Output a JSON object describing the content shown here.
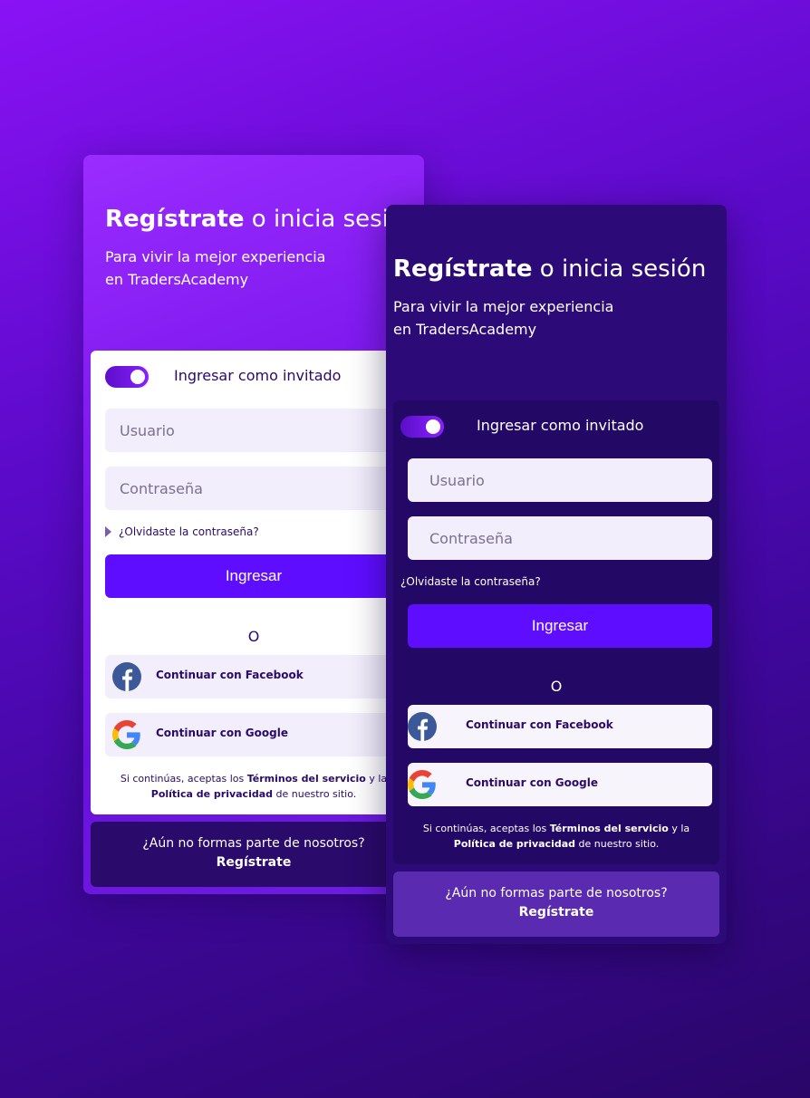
{
  "auth": {
    "heading_bold": "Regístrate",
    "heading_rest": "o inicia sesión",
    "subtitle": "Para vivir la mejor experiencia en TradersAcademy",
    "guest_toggle_label": "Ingresar como invitado",
    "username_placeholder": "Usuario",
    "password_placeholder": "Contraseña",
    "forgot_password": "¿Olvidaste la contraseña?",
    "login_button": "Ingresar",
    "or_separator": "O",
    "facebook_button": "Continuar con Facebook",
    "google_button": "Continuar con Google",
    "legal_prefix": "Si continúas, aceptas los",
    "terms_link": "Términos del servicio",
    "legal_and": "y la",
    "privacy_link": "Política de privacidad",
    "legal_suffix": "de nuestro sitio.",
    "no_account_text": "¿Aún no formas parte de nosotros?",
    "signup_link": "Regístrate"
  },
  "colors": {
    "primary": "#5f0dff",
    "dark_panel": "#2a0a6a",
    "field_bg": "#f2eefc",
    "facebook": "#3b5998"
  },
  "icons": {
    "facebook": "facebook-icon",
    "google": "google-icon"
  }
}
